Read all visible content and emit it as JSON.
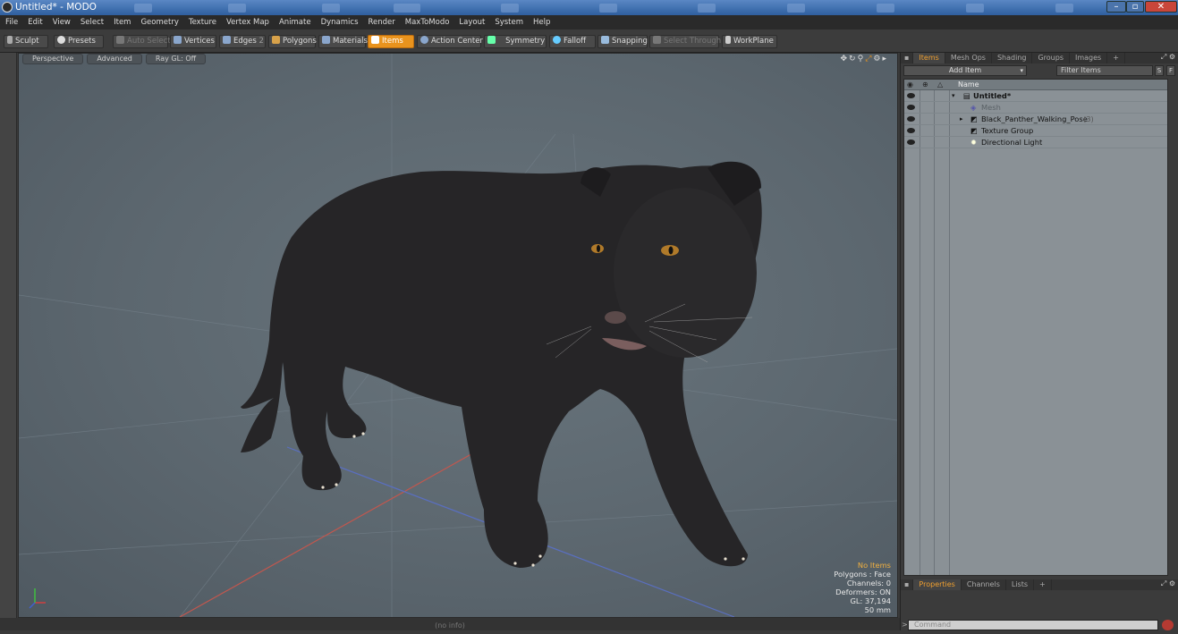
{
  "window": {
    "title": "Untitled* - MODO"
  },
  "menu": [
    "File",
    "Edit",
    "View",
    "Select",
    "Item",
    "Geometry",
    "Texture",
    "Vertex Map",
    "Animate",
    "Dynamics",
    "Render",
    "MaxToModo",
    "Layout",
    "System",
    "Help"
  ],
  "toolbar": {
    "sculpt": "Sculpt",
    "presets": "Presets",
    "auto_select": "Auto Select",
    "vertices": "Vertices",
    "edges": "Edges",
    "edges_count": "2",
    "polygons": "Polygons",
    "materials": "Materials",
    "items": "Items",
    "action_center": "Action Center",
    "symmetry": "Symmetry",
    "falloff": "Falloff",
    "snapping": "Snapping",
    "select_through": "Select Through",
    "workplane": "WorkPlane"
  },
  "viewport": {
    "tabs": [
      "Perspective",
      "Advanced",
      "Ray GL: Off"
    ],
    "stats": {
      "selection": "No Items",
      "polygons": "Polygons : Face",
      "channels": "Channels: 0",
      "deformers": "Deformers: ON",
      "gl": "GL: 37,194",
      "focal": "50 mm"
    }
  },
  "right_panel": {
    "tabs": [
      "Items",
      "Mesh Ops",
      "Shading",
      "Groups",
      "Images",
      "+"
    ],
    "add_item": "Add Item",
    "filter_placeholder": "Filter Items",
    "s_btn": "S",
    "f_btn": "F",
    "column_name": "Name",
    "items": [
      {
        "label": "Untitled*",
        "indent": 0,
        "count": ""
      },
      {
        "label": "Mesh",
        "indent": 1,
        "count": ""
      },
      {
        "label": "Black_Panther_Walking_Pose",
        "indent": 1,
        "count": "(3)"
      },
      {
        "label": "Texture Group",
        "indent": 1,
        "count": ""
      },
      {
        "label": "Directional Light",
        "indent": 1,
        "count": ""
      }
    ],
    "bottom_tabs": [
      "Properties",
      "Channels",
      "Lists",
      "+"
    ]
  },
  "statusbar": {
    "info": "(no info)"
  },
  "command": {
    "placeholder": "Command"
  },
  "colors": {
    "accent": "#e9931d",
    "viewport_bg": "#5f6a72",
    "list_bg": "#8a9196"
  }
}
